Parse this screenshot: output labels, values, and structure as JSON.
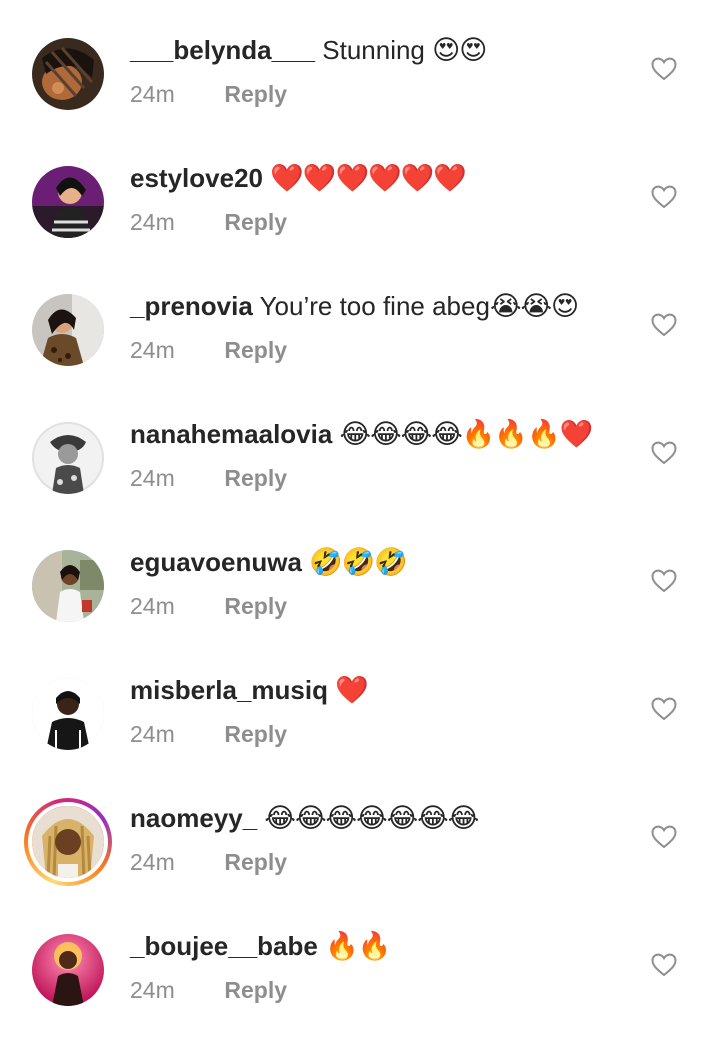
{
  "comments": [
    {
      "username": "___belynda___",
      "text": "Stunning",
      "emoji": "😍😍",
      "time": "24m",
      "reply_label": "Reply"
    },
    {
      "username": "estylove20",
      "text": "",
      "emoji": "❤️❤️❤️❤️❤️❤️",
      "time": "24m",
      "reply_label": "Reply"
    },
    {
      "username": "_prenovia",
      "text": "You’re too fine abeg",
      "emoji": "😭😭😍",
      "time": "24m",
      "reply_label": "Reply"
    },
    {
      "username": "nanahemaalovia",
      "text": "",
      "emoji": "😂😂😂😂🔥🔥🔥❤️",
      "time": "24m",
      "reply_label": "Reply"
    },
    {
      "username": "eguavoenuwa",
      "text": "",
      "emoji": "🤣🤣🤣",
      "time": "24m",
      "reply_label": "Reply"
    },
    {
      "username": "misberla_musiq",
      "text": "",
      "emoji": "❤️",
      "time": "24m",
      "reply_label": "Reply"
    },
    {
      "username": "naomeyy_",
      "text": "",
      "emoji": "😂😂😂😂😂😂😂",
      "time": "24m",
      "reply_label": "Reply"
    },
    {
      "username": "_boujee__babe",
      "text": "",
      "emoji": "🔥🔥",
      "time": "24m",
      "reply_label": "Reply"
    }
  ],
  "icons": {
    "like": "heart-outline-icon",
    "avatar": "user-avatar-photo"
  },
  "colors": {
    "username": "#262626",
    "meta": "#8e8e8e",
    "heart_outline": "#8e8e8e",
    "story_ring_start": "#fa7e1e",
    "story_ring_end": "#d62976"
  }
}
